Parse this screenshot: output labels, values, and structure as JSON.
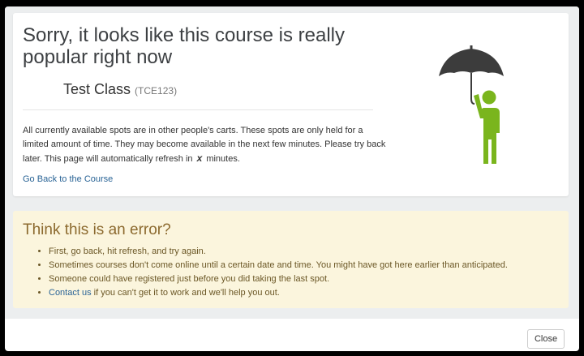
{
  "headline": "Sorry, it looks like this course is really popular right now",
  "course": {
    "name": "Test Class",
    "code": "(TCE123)"
  },
  "explanation": {
    "text_before": "All currently available spots are in other people's carts. These spots are only held for a limited amount of time. They may become available in the next few minutes. Please try back later. This page will automatically refresh in",
    "variable": "x",
    "text_after": "minutes."
  },
  "back_link": "Go Back to the Course",
  "illustration": {
    "icon": "person-with-umbrella-icon",
    "umbrella_color": "#3c3c3c",
    "person_color": "#7ab51d"
  },
  "error_section": {
    "title": "Think this is an error?",
    "tips": [
      "First, go back, hit refresh, and try again.",
      "Sometimes courses don't come online until a certain date and time. You might have got here earlier than anticipated.",
      "Someone could have registered just before you did taking the last spot."
    ],
    "contact_link": "Contact us",
    "contact_suffix": " if you can't get it to work and we'll help you out."
  },
  "close_button": "Close",
  "colors": {
    "link": "#2a6496",
    "warning_bg": "#fbf5dd",
    "warning_text": "#8c6a2f"
  }
}
